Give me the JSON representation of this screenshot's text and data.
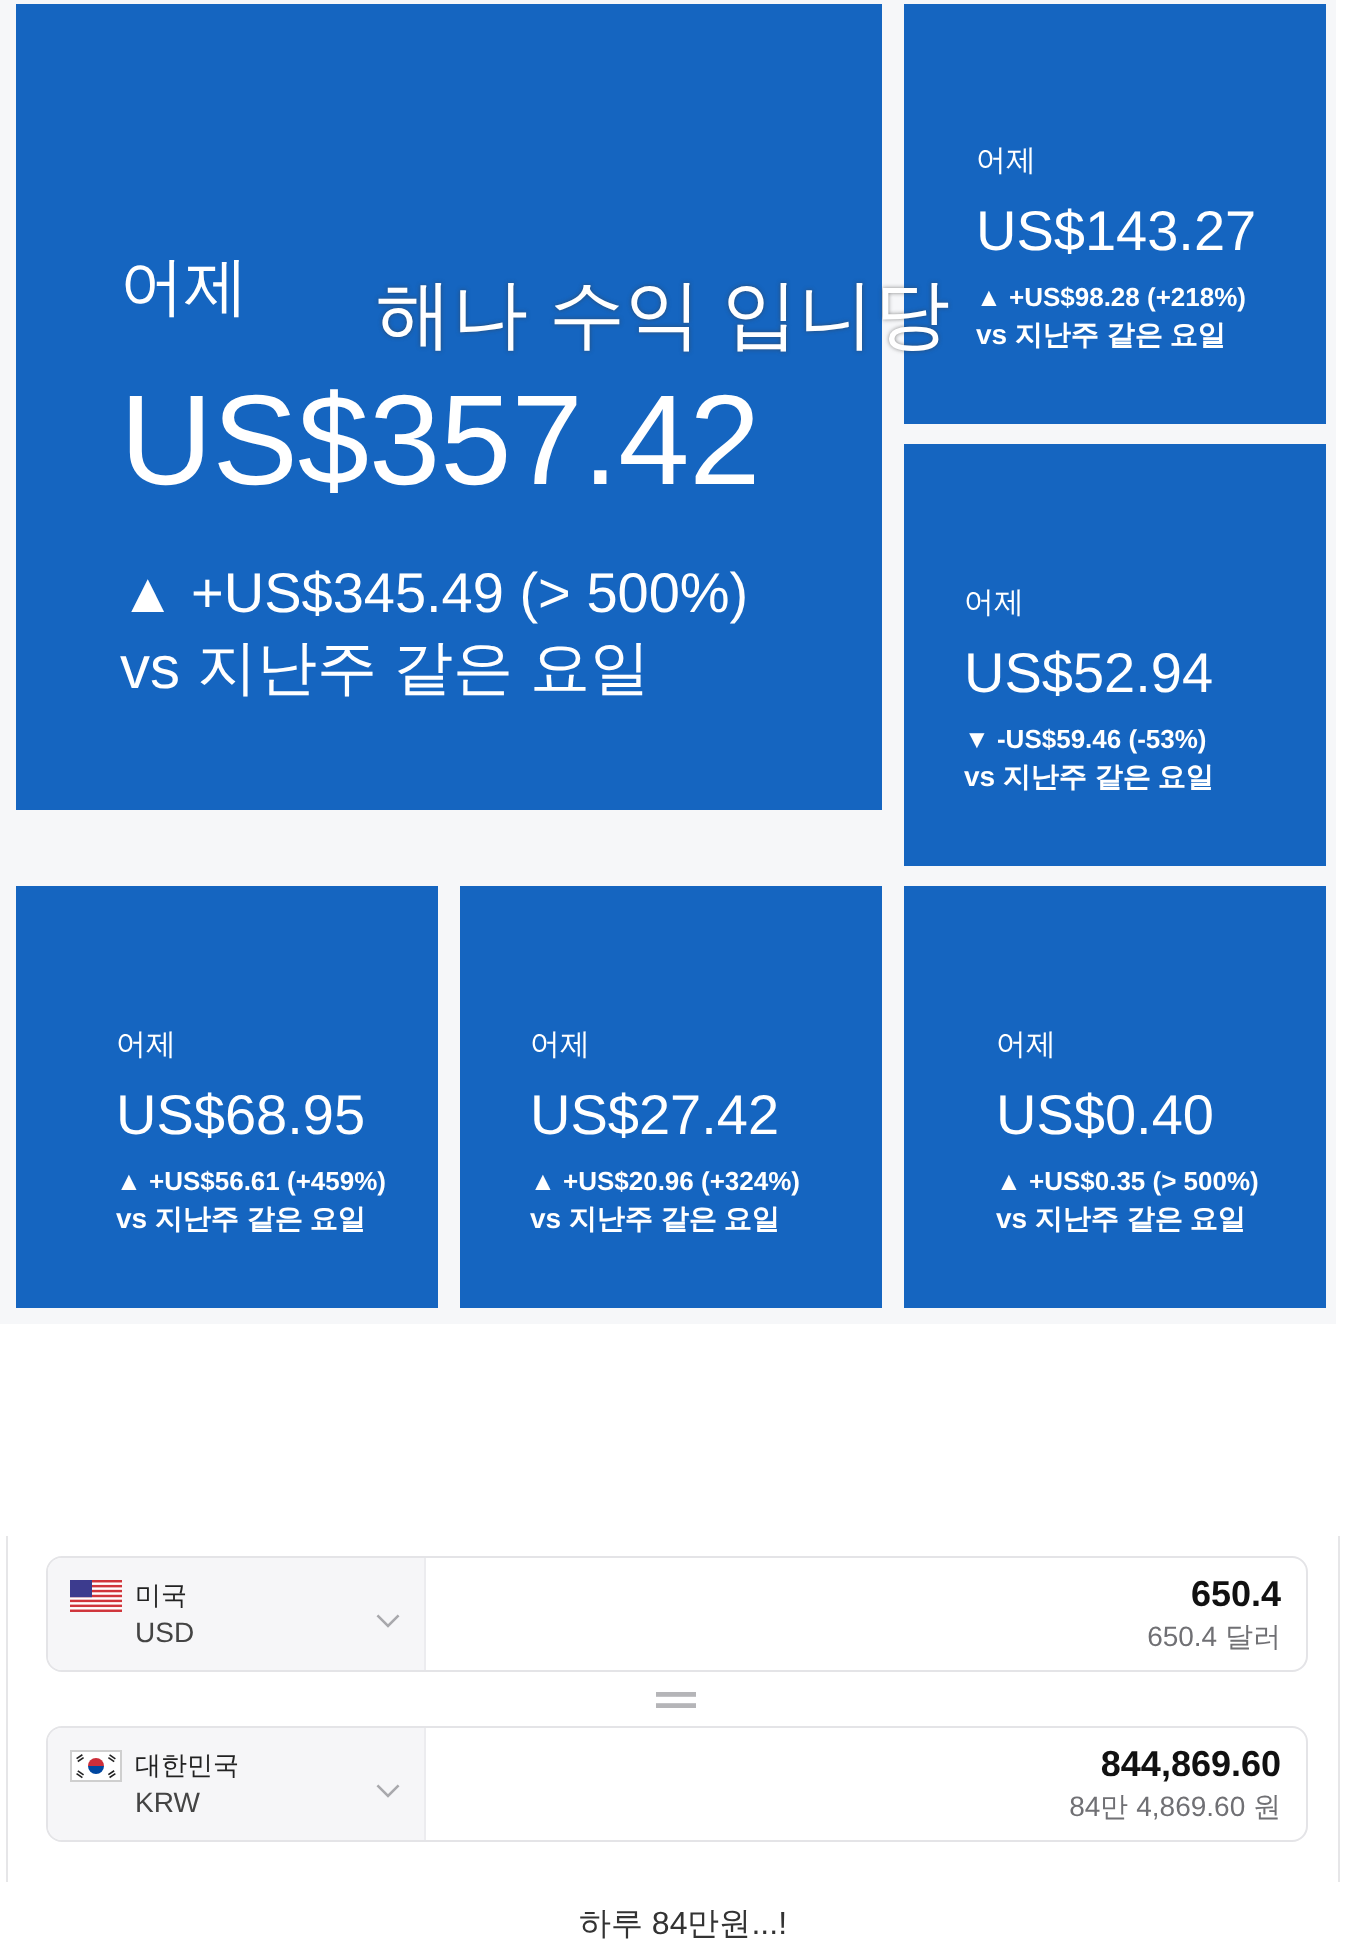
{
  "dashboard": {
    "tiles": [
      {
        "kind": "large",
        "label": "어제",
        "value": "US$357.42",
        "change": "▲ +US$345.49 (> 500%)",
        "comparison": "vs 지난주 같은 요일"
      },
      {
        "kind": "small",
        "label": "어제",
        "value": "US$143.27",
        "change": "▲ +US$98.28 (+218%)",
        "comparison": "vs 지난주 같은 요일"
      },
      {
        "kind": "small",
        "label": "어제",
        "value": "US$52.94",
        "change": "▼ -US$59.46 (-53%)",
        "comparison": "vs 지난주 같은 요일"
      },
      {
        "kind": "small",
        "label": "어제",
        "value": "US$68.95",
        "change": "▲ +US$56.61 (+459%)",
        "comparison": "vs 지난주 같은 요일"
      },
      {
        "kind": "small",
        "label": "어제",
        "value": "US$27.42",
        "change": "▲ +US$20.96 (+324%)",
        "comparison": "vs 지난주 같은 요일"
      },
      {
        "kind": "small",
        "label": "어제",
        "value": "US$0.40",
        "change": "▲ +US$0.35 (> 500%)",
        "comparison": "vs 지난주 같은 요일"
      }
    ]
  },
  "overlay_caption": "해나 수익 입니당",
  "converter": {
    "rows": [
      {
        "country": "미국",
        "code": "USD",
        "amount": "650.4",
        "amount_words": "650.4 달러"
      },
      {
        "country": "대한민국",
        "code": "KRW",
        "amount": "844,869.60",
        "amount_words": "84만 4,869.60 원"
      }
    ]
  },
  "caption": "하루 84만원...!"
}
